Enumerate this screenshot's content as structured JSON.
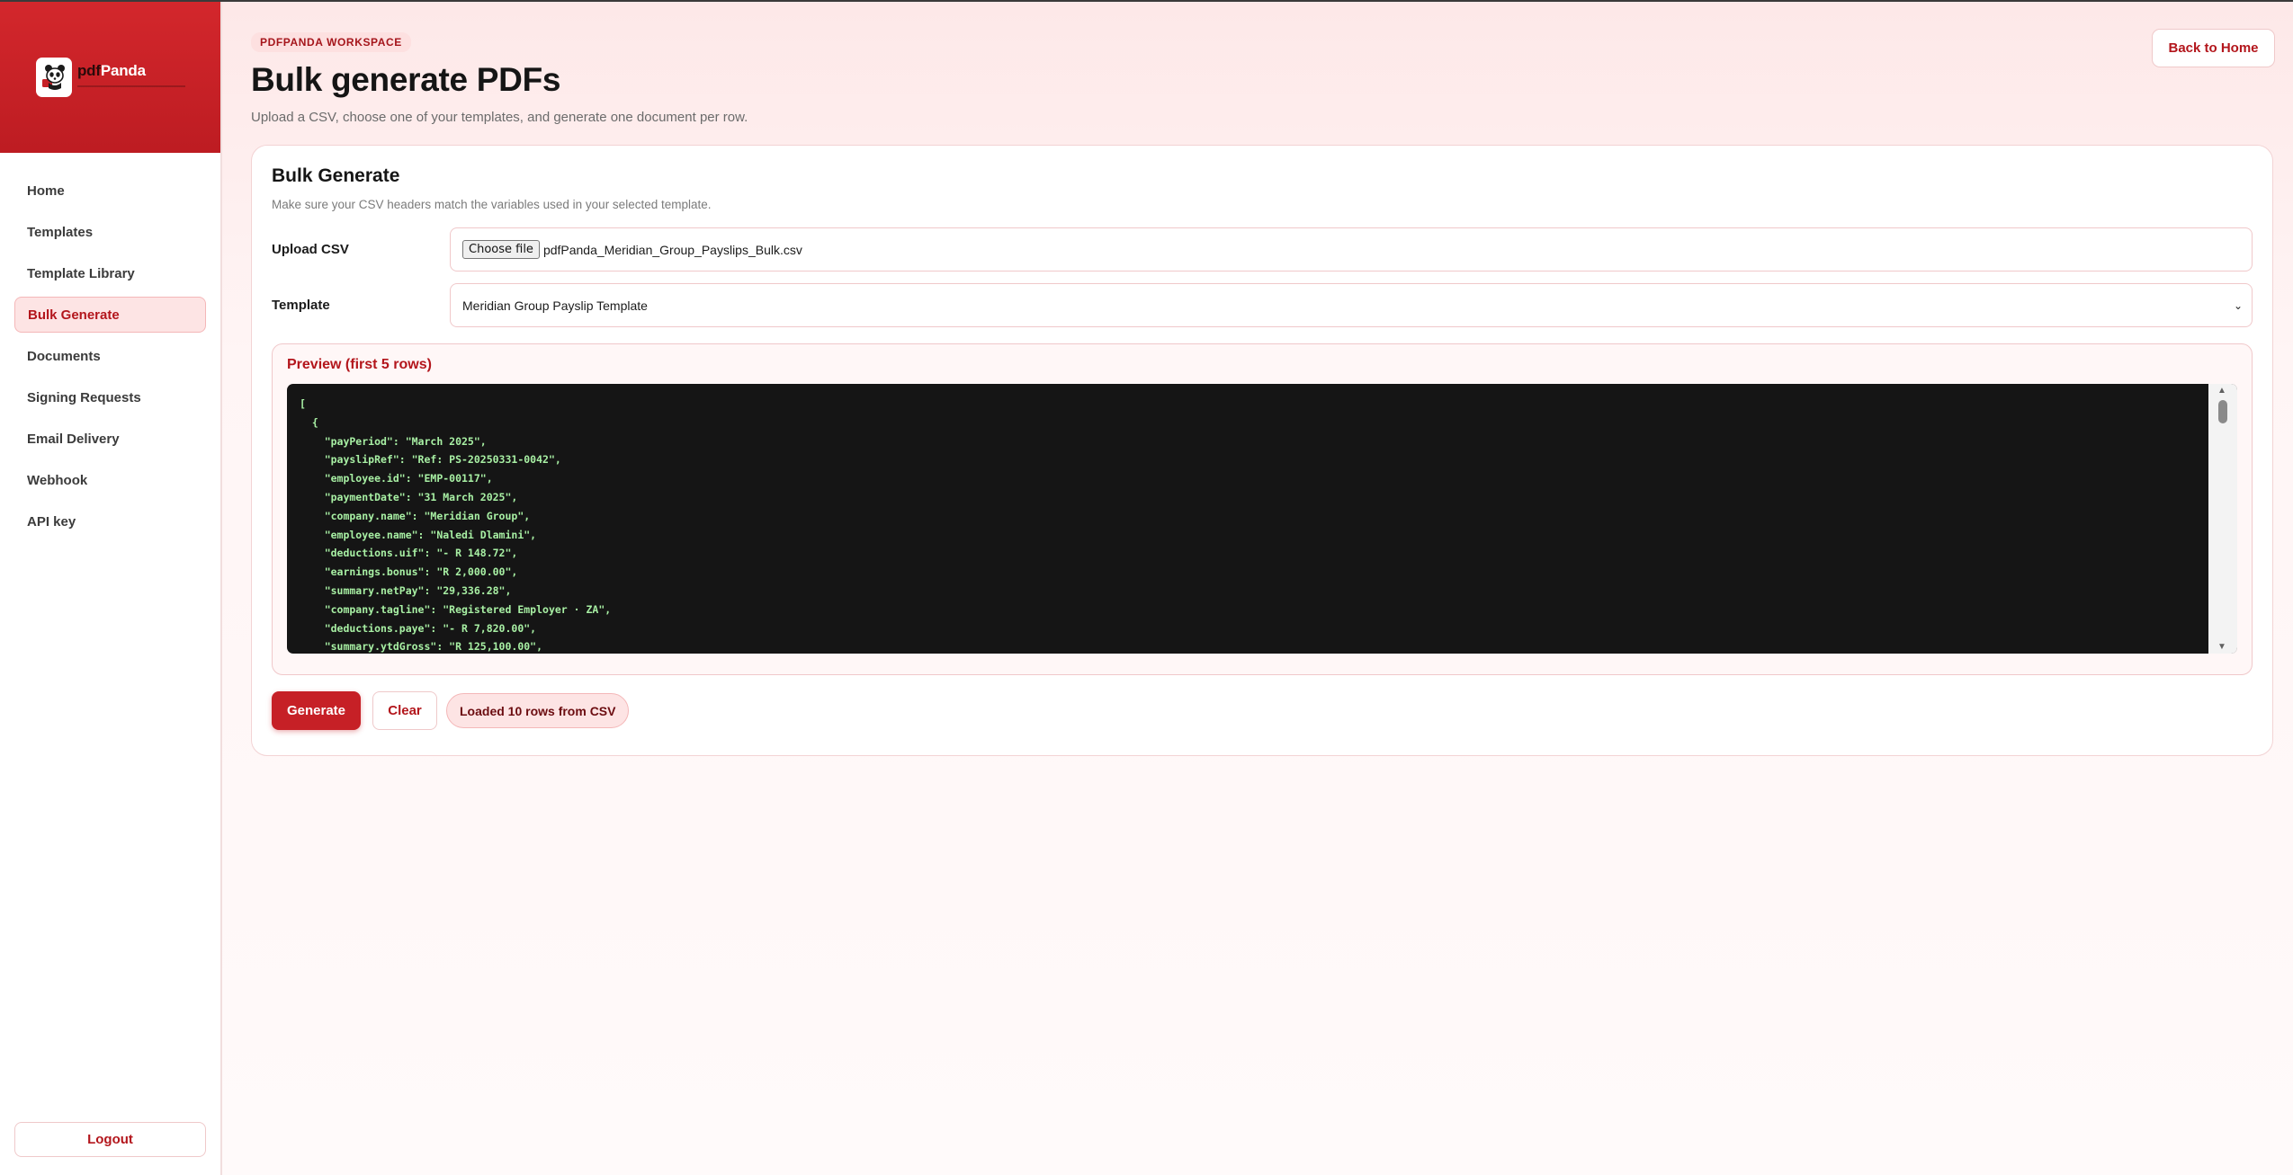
{
  "brand": {
    "name_prefix": "pdf",
    "name_suffix": "Panda",
    "logo_icon": "panda-logo-icon",
    "accent_color": "#c62026"
  },
  "sidebar": {
    "items": [
      {
        "label": "Home",
        "active": false
      },
      {
        "label": "Templates",
        "active": false
      },
      {
        "label": "Template Library",
        "active": false
      },
      {
        "label": "Bulk Generate",
        "active": true
      },
      {
        "label": "Documents",
        "active": false
      },
      {
        "label": "Signing Requests",
        "active": false
      },
      {
        "label": "Email Delivery",
        "active": false
      },
      {
        "label": "Webhook",
        "active": false
      },
      {
        "label": "API key",
        "active": false
      }
    ],
    "logout_label": "Logout"
  },
  "header": {
    "kicker": "PDFPANDA WORKSPACE",
    "title": "Bulk generate PDFs",
    "subtitle": "Upload a CSV, choose one of your templates, and generate one document per row.",
    "back_label": "Back to Home"
  },
  "card": {
    "title": "Bulk Generate",
    "subtitle": "Make sure your CSV headers match the variables used in your selected template.",
    "upload": {
      "label": "Upload CSV",
      "button_label": "Choose file",
      "file_name": "pdfPanda_Meridian_Group_Payslips_Bulk.csv"
    },
    "template": {
      "label": "Template",
      "selected": "Meridian Group Payslip Template"
    },
    "preview": {
      "title": "Preview (first 5 rows)",
      "code": "[\n  {\n    \"payPeriod\": \"March 2025\",\n    \"payslipRef\": \"Ref: PS-20250331-0042\",\n    \"employee.id\": \"EMP-00117\",\n    \"paymentDate\": \"31 March 2025\",\n    \"company.name\": \"Meridian Group\",\n    \"employee.name\": \"Naledi Dlamini\",\n    \"deductions.uif\": \"- R 148.72\",\n    \"earnings.bonus\": \"R 2,000.00\",\n    \"summary.netPay\": \"29,336.28\",\n    \"company.tagline\": \"Registered Employer · ZA\",\n    \"deductions.paye\": \"- R 7,820.00\",\n    \"summary.ytdGross\": \"R 125,100.00\","
    },
    "actions": {
      "generate_label": "Generate",
      "clear_label": "Clear",
      "status": "Loaded 10 rows from CSV"
    }
  }
}
